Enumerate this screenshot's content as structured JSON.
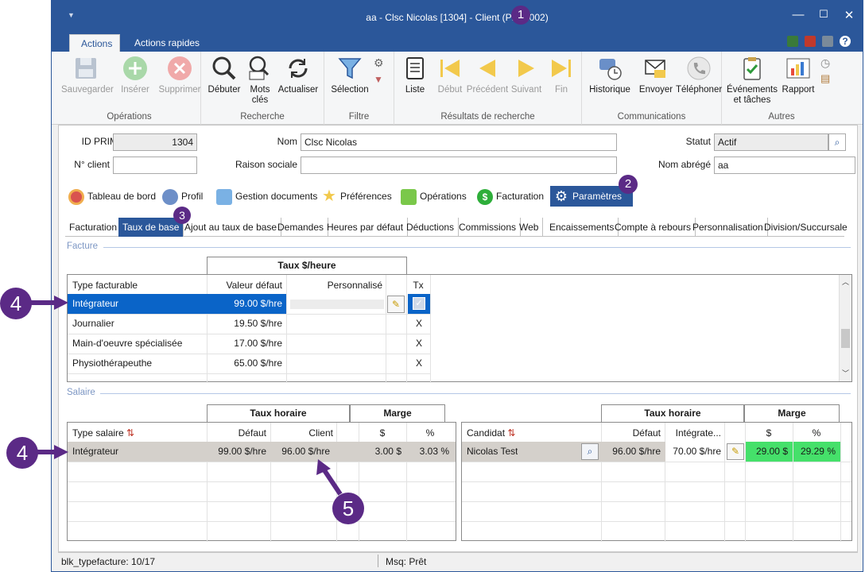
{
  "window": {
    "title": "aa - Clsc Nicolas [1304] - Client (PRIM002)",
    "minimize": "—",
    "maximize": "☐",
    "close": "✕"
  },
  "ribbon_tabs": [
    "Actions",
    "Actions rapides"
  ],
  "ribbon": {
    "operations": {
      "label": "Opérations",
      "save": "Sauvegarder",
      "insert": "Insérer",
      "delete": "Supprimer"
    },
    "search": {
      "label": "Recherche",
      "start": "Débuter",
      "keywords": "Mots clés",
      "refresh": "Actualiser"
    },
    "filter": {
      "label": "Filtre",
      "selection": "Sélection"
    },
    "results": {
      "label": "Résultats de recherche",
      "list": "Liste",
      "first": "Début",
      "prev": "Précédent",
      "next": "Suivant",
      "last": "Fin"
    },
    "comms": {
      "label": "Communications",
      "history": "Historique",
      "send": "Envoyer",
      "phone": "Téléphoner"
    },
    "others": {
      "label": "Autres",
      "events": "Événements et tâches",
      "report": "Rapport"
    }
  },
  "form": {
    "id_label": "ID PRIM",
    "id_value": "1304",
    "name_label": "Nom",
    "name_value": "Clsc Nicolas",
    "status_label": "Statut",
    "status_value": "Actif",
    "client_no_label": "N° client",
    "client_no_value": "",
    "company_label": "Raison sociale",
    "company_value": "",
    "short_label": "Nom abrégé",
    "short_value": "aa"
  },
  "main_tabs": [
    "Tableau de bord",
    "Profil",
    "Gestion documents",
    "Préférences",
    "Opérations",
    "Facturation",
    "Paramètres"
  ],
  "sub_tabs": [
    "Facturation",
    "Taux de base",
    "Ajout au taux de base",
    "Demandes",
    "Heures par défaut",
    "Déductions",
    "Commissions",
    "Web",
    "Encaissements",
    "Compte à rebours",
    "Personnalisation",
    "Division/Succursale"
  ],
  "facture": {
    "section": "Facture",
    "group_header": "Taux $/heure",
    "headers": [
      "Type facturable",
      "Valeur défaut",
      "Personnalisé",
      "Tx"
    ],
    "rows": [
      {
        "type": "Intégrateur",
        "default": "99.00 $/hre",
        "custom": "",
        "tx": "✓"
      },
      {
        "type": "Journalier",
        "default": "19.50 $/hre",
        "custom": "",
        "tx": "X"
      },
      {
        "type": "Main-d'oeuvre spécialisée",
        "default": "17.00 $/hre",
        "custom": "",
        "tx": "X"
      },
      {
        "type": "Physiothérapeuthe",
        "default": "65.00 $/hre",
        "custom": "",
        "tx": "X"
      }
    ]
  },
  "salaire": {
    "section": "Salaire",
    "left": {
      "group_rate": "Taux horaire",
      "group_margin": "Marge",
      "headers": [
        "Type salaire",
        "Défaut",
        "Client",
        "$",
        "%"
      ],
      "rows": [
        {
          "type": "Intégrateur",
          "default": "99.00 $/hre",
          "client": "96.00 $/hre",
          "margin_d": "3.00 $",
          "margin_p": "3.03 %"
        }
      ]
    },
    "right": {
      "group_rate": "Taux horaire",
      "group_margin": "Marge",
      "headers": [
        "Candidat",
        "Défaut",
        "Intégrate...",
        "$",
        "%"
      ],
      "rows": [
        {
          "name": "Nicolas Test",
          "default": "96.00 $/hre",
          "integ": "70.00 $/hre",
          "margin_d": "29.00 $",
          "margin_p": "29.29 %"
        }
      ]
    }
  },
  "status": {
    "left": "blk_typefacture: 10/17",
    "msg": "Msq: Prêt"
  },
  "callouts": [
    "1",
    "2",
    "3",
    "4",
    "4",
    "5"
  ],
  "colors": {
    "accent": "#2b579a",
    "selection": "#0a64c8",
    "callout": "#5b2a86",
    "green": "#45e06a"
  }
}
